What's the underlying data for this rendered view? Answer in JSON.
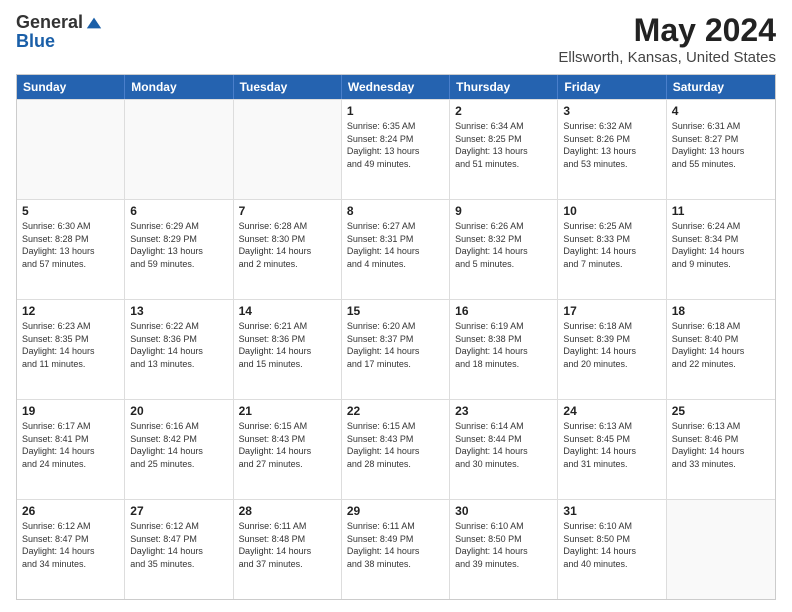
{
  "logo": {
    "general": "General",
    "blue": "Blue"
  },
  "header": {
    "title": "May 2024",
    "subtitle": "Ellsworth, Kansas, United States"
  },
  "weekdays": [
    "Sunday",
    "Monday",
    "Tuesday",
    "Wednesday",
    "Thursday",
    "Friday",
    "Saturday"
  ],
  "weeks": [
    [
      {
        "day": "",
        "sunrise": "",
        "sunset": "",
        "daylight": "",
        "empty": true
      },
      {
        "day": "",
        "sunrise": "",
        "sunset": "",
        "daylight": "",
        "empty": true
      },
      {
        "day": "",
        "sunrise": "",
        "sunset": "",
        "daylight": "",
        "empty": true
      },
      {
        "day": "1",
        "sunrise": "Sunrise: 6:35 AM",
        "sunset": "Sunset: 8:24 PM",
        "daylight1": "Daylight: 13 hours",
        "daylight2": "and 49 minutes."
      },
      {
        "day": "2",
        "sunrise": "Sunrise: 6:34 AM",
        "sunset": "Sunset: 8:25 PM",
        "daylight1": "Daylight: 13 hours",
        "daylight2": "and 51 minutes."
      },
      {
        "day": "3",
        "sunrise": "Sunrise: 6:32 AM",
        "sunset": "Sunset: 8:26 PM",
        "daylight1": "Daylight: 13 hours",
        "daylight2": "and 53 minutes."
      },
      {
        "day": "4",
        "sunrise": "Sunrise: 6:31 AM",
        "sunset": "Sunset: 8:27 PM",
        "daylight1": "Daylight: 13 hours",
        "daylight2": "and 55 minutes."
      }
    ],
    [
      {
        "day": "5",
        "sunrise": "Sunrise: 6:30 AM",
        "sunset": "Sunset: 8:28 PM",
        "daylight1": "Daylight: 13 hours",
        "daylight2": "and 57 minutes."
      },
      {
        "day": "6",
        "sunrise": "Sunrise: 6:29 AM",
        "sunset": "Sunset: 8:29 PM",
        "daylight1": "Daylight: 13 hours",
        "daylight2": "and 59 minutes."
      },
      {
        "day": "7",
        "sunrise": "Sunrise: 6:28 AM",
        "sunset": "Sunset: 8:30 PM",
        "daylight1": "Daylight: 14 hours",
        "daylight2": "and 2 minutes."
      },
      {
        "day": "8",
        "sunrise": "Sunrise: 6:27 AM",
        "sunset": "Sunset: 8:31 PM",
        "daylight1": "Daylight: 14 hours",
        "daylight2": "and 4 minutes."
      },
      {
        "day": "9",
        "sunrise": "Sunrise: 6:26 AM",
        "sunset": "Sunset: 8:32 PM",
        "daylight1": "Daylight: 14 hours",
        "daylight2": "and 5 minutes."
      },
      {
        "day": "10",
        "sunrise": "Sunrise: 6:25 AM",
        "sunset": "Sunset: 8:33 PM",
        "daylight1": "Daylight: 14 hours",
        "daylight2": "and 7 minutes."
      },
      {
        "day": "11",
        "sunrise": "Sunrise: 6:24 AM",
        "sunset": "Sunset: 8:34 PM",
        "daylight1": "Daylight: 14 hours",
        "daylight2": "and 9 minutes."
      }
    ],
    [
      {
        "day": "12",
        "sunrise": "Sunrise: 6:23 AM",
        "sunset": "Sunset: 8:35 PM",
        "daylight1": "Daylight: 14 hours",
        "daylight2": "and 11 minutes."
      },
      {
        "day": "13",
        "sunrise": "Sunrise: 6:22 AM",
        "sunset": "Sunset: 8:36 PM",
        "daylight1": "Daylight: 14 hours",
        "daylight2": "and 13 minutes."
      },
      {
        "day": "14",
        "sunrise": "Sunrise: 6:21 AM",
        "sunset": "Sunset: 8:36 PM",
        "daylight1": "Daylight: 14 hours",
        "daylight2": "and 15 minutes."
      },
      {
        "day": "15",
        "sunrise": "Sunrise: 6:20 AM",
        "sunset": "Sunset: 8:37 PM",
        "daylight1": "Daylight: 14 hours",
        "daylight2": "and 17 minutes."
      },
      {
        "day": "16",
        "sunrise": "Sunrise: 6:19 AM",
        "sunset": "Sunset: 8:38 PM",
        "daylight1": "Daylight: 14 hours",
        "daylight2": "and 18 minutes."
      },
      {
        "day": "17",
        "sunrise": "Sunrise: 6:18 AM",
        "sunset": "Sunset: 8:39 PM",
        "daylight1": "Daylight: 14 hours",
        "daylight2": "and 20 minutes."
      },
      {
        "day": "18",
        "sunrise": "Sunrise: 6:18 AM",
        "sunset": "Sunset: 8:40 PM",
        "daylight1": "Daylight: 14 hours",
        "daylight2": "and 22 minutes."
      }
    ],
    [
      {
        "day": "19",
        "sunrise": "Sunrise: 6:17 AM",
        "sunset": "Sunset: 8:41 PM",
        "daylight1": "Daylight: 14 hours",
        "daylight2": "and 24 minutes."
      },
      {
        "day": "20",
        "sunrise": "Sunrise: 6:16 AM",
        "sunset": "Sunset: 8:42 PM",
        "daylight1": "Daylight: 14 hours",
        "daylight2": "and 25 minutes."
      },
      {
        "day": "21",
        "sunrise": "Sunrise: 6:15 AM",
        "sunset": "Sunset: 8:43 PM",
        "daylight1": "Daylight: 14 hours",
        "daylight2": "and 27 minutes."
      },
      {
        "day": "22",
        "sunrise": "Sunrise: 6:15 AM",
        "sunset": "Sunset: 8:43 PM",
        "daylight1": "Daylight: 14 hours",
        "daylight2": "and 28 minutes."
      },
      {
        "day": "23",
        "sunrise": "Sunrise: 6:14 AM",
        "sunset": "Sunset: 8:44 PM",
        "daylight1": "Daylight: 14 hours",
        "daylight2": "and 30 minutes."
      },
      {
        "day": "24",
        "sunrise": "Sunrise: 6:13 AM",
        "sunset": "Sunset: 8:45 PM",
        "daylight1": "Daylight: 14 hours",
        "daylight2": "and 31 minutes."
      },
      {
        "day": "25",
        "sunrise": "Sunrise: 6:13 AM",
        "sunset": "Sunset: 8:46 PM",
        "daylight1": "Daylight: 14 hours",
        "daylight2": "and 33 minutes."
      }
    ],
    [
      {
        "day": "26",
        "sunrise": "Sunrise: 6:12 AM",
        "sunset": "Sunset: 8:47 PM",
        "daylight1": "Daylight: 14 hours",
        "daylight2": "and 34 minutes."
      },
      {
        "day": "27",
        "sunrise": "Sunrise: 6:12 AM",
        "sunset": "Sunset: 8:47 PM",
        "daylight1": "Daylight: 14 hours",
        "daylight2": "and 35 minutes."
      },
      {
        "day": "28",
        "sunrise": "Sunrise: 6:11 AM",
        "sunset": "Sunset: 8:48 PM",
        "daylight1": "Daylight: 14 hours",
        "daylight2": "and 37 minutes."
      },
      {
        "day": "29",
        "sunrise": "Sunrise: 6:11 AM",
        "sunset": "Sunset: 8:49 PM",
        "daylight1": "Daylight: 14 hours",
        "daylight2": "and 38 minutes."
      },
      {
        "day": "30",
        "sunrise": "Sunrise: 6:10 AM",
        "sunset": "Sunset: 8:50 PM",
        "daylight1": "Daylight: 14 hours",
        "daylight2": "and 39 minutes."
      },
      {
        "day": "31",
        "sunrise": "Sunrise: 6:10 AM",
        "sunset": "Sunset: 8:50 PM",
        "daylight1": "Daylight: 14 hours",
        "daylight2": "and 40 minutes."
      },
      {
        "day": "",
        "sunrise": "",
        "sunset": "",
        "daylight": "",
        "empty": true
      }
    ]
  ]
}
